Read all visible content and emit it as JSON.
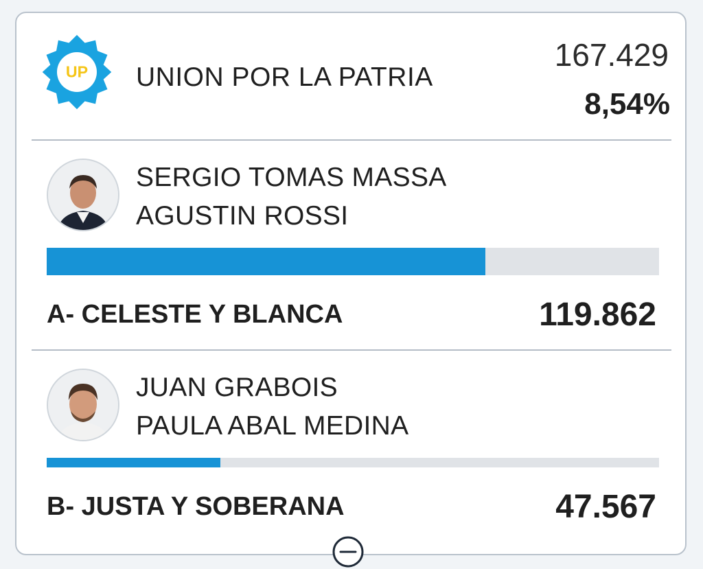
{
  "party": {
    "logo_text": "UP",
    "name": "UNION POR LA PATRIA",
    "votes": "167.429",
    "percent": "8,54%",
    "logo_colors": {
      "star": "#1aa3e0",
      "disc": "#ffffff",
      "text": "#f5c518"
    }
  },
  "lists": [
    {
      "candidates": [
        "SERGIO TOMAS MASSA",
        "AGUSTIN ROSSI"
      ],
      "list_name": "A- CELESTE Y BLANCA",
      "votes": "119.862",
      "share": 0.716
    },
    {
      "candidates": [
        "JUAN GRABOIS",
        "PAULA ABAL MEDINA"
      ],
      "list_name": "B- JUSTA Y SOBERANA",
      "votes": "47.567",
      "share": 0.284
    }
  ],
  "colors": {
    "bar_fill": "#1793d6",
    "bar_track": "#e0e3e7",
    "divider": "#b4bcc6"
  },
  "icons": {
    "party_logo": "up-sun-logo",
    "collapse": "minus-circle-icon"
  }
}
